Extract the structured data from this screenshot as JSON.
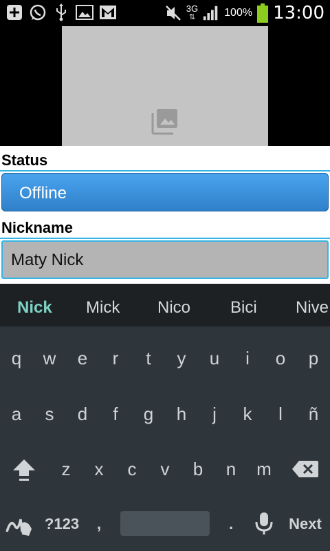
{
  "status_bar": {
    "icons_left": [
      "add-icon",
      "whatsapp-icon",
      "usb-icon",
      "image-icon",
      "gmail-icon"
    ],
    "icons_right": [
      "mute-icon",
      "signal-icon",
      "battery-icon"
    ],
    "network": "3G",
    "battery": "100%",
    "time": "13:00"
  },
  "profile": {
    "photo_icon": "photo-library-icon"
  },
  "form": {
    "status_label": "Status",
    "status_value": "Offline",
    "nickname_label": "Nickname",
    "nickname_value": "Maty Nick"
  },
  "keyboard": {
    "suggestions": [
      "Nick",
      "Mick",
      "Nico",
      "Bici",
      "Nive"
    ],
    "row1": [
      "q",
      "w",
      "e",
      "r",
      "t",
      "y",
      "u",
      "i",
      "o",
      "p"
    ],
    "row2": [
      "a",
      "s",
      "d",
      "f",
      "g",
      "h",
      "j",
      "k",
      "l",
      "ñ"
    ],
    "row3": [
      "z",
      "x",
      "c",
      "v",
      "b",
      "n",
      "m"
    ],
    "symbols_label": "?123",
    "comma": ",",
    "period": ".",
    "action_label": "Next",
    "colors": {
      "accent": "#33b5e5",
      "suggestion_highlight": "#7fd1c5",
      "spinner": "#3a8fdc"
    }
  }
}
